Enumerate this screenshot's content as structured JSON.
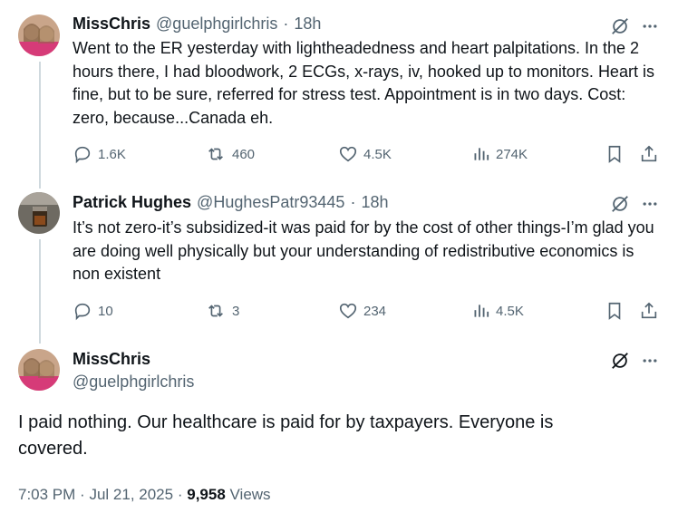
{
  "tweets": [
    {
      "name": "MissChris",
      "handle": "@guelphgirlchris",
      "time": "18h",
      "text": "Went to the ER yesterday with lightheadedness and heart palpitations. In the 2 hours  there, I had bloodwork, 2 ECGs, x-rays, iv, hooked up to monitors. Heart is fine, but to be sure, referred for stress test. Appointment is in two days. Cost: zero, because...Canada eh.",
      "replies": "1.6K",
      "reposts": "460",
      "likes": "4.5K",
      "views": "274K"
    },
    {
      "name": "Patrick Hughes",
      "handle": "@HughesPatr93445",
      "time": "18h",
      "text": "It’s not zero-it’s subsidized-it was paid for by the cost of other things-I’m glad you are doing well physically but your understanding of redistributive economics is non existent",
      "replies": "10",
      "reposts": "3",
      "likes": "234",
      "views": "4.5K"
    }
  ],
  "main_tweet": {
    "name": "MissChris",
    "handle": "@guelphgirlchris",
    "text": "I paid nothing. Our healthcare is paid for by taxpayers. Everyone is covered.",
    "time": "7:03 PM",
    "date": "Jul 21, 2025",
    "view_count": "9,958",
    "views_label": "Views"
  },
  "separator": "·",
  "icons": [
    "reply-icon",
    "repost-icon",
    "like-icon",
    "views-icon",
    "bookmark-icon",
    "share-icon",
    "grok-icon",
    "more-icon"
  ],
  "colors": {
    "text": "#0f1419",
    "secondary": "#536471",
    "thread_line": "#cfd9de"
  }
}
